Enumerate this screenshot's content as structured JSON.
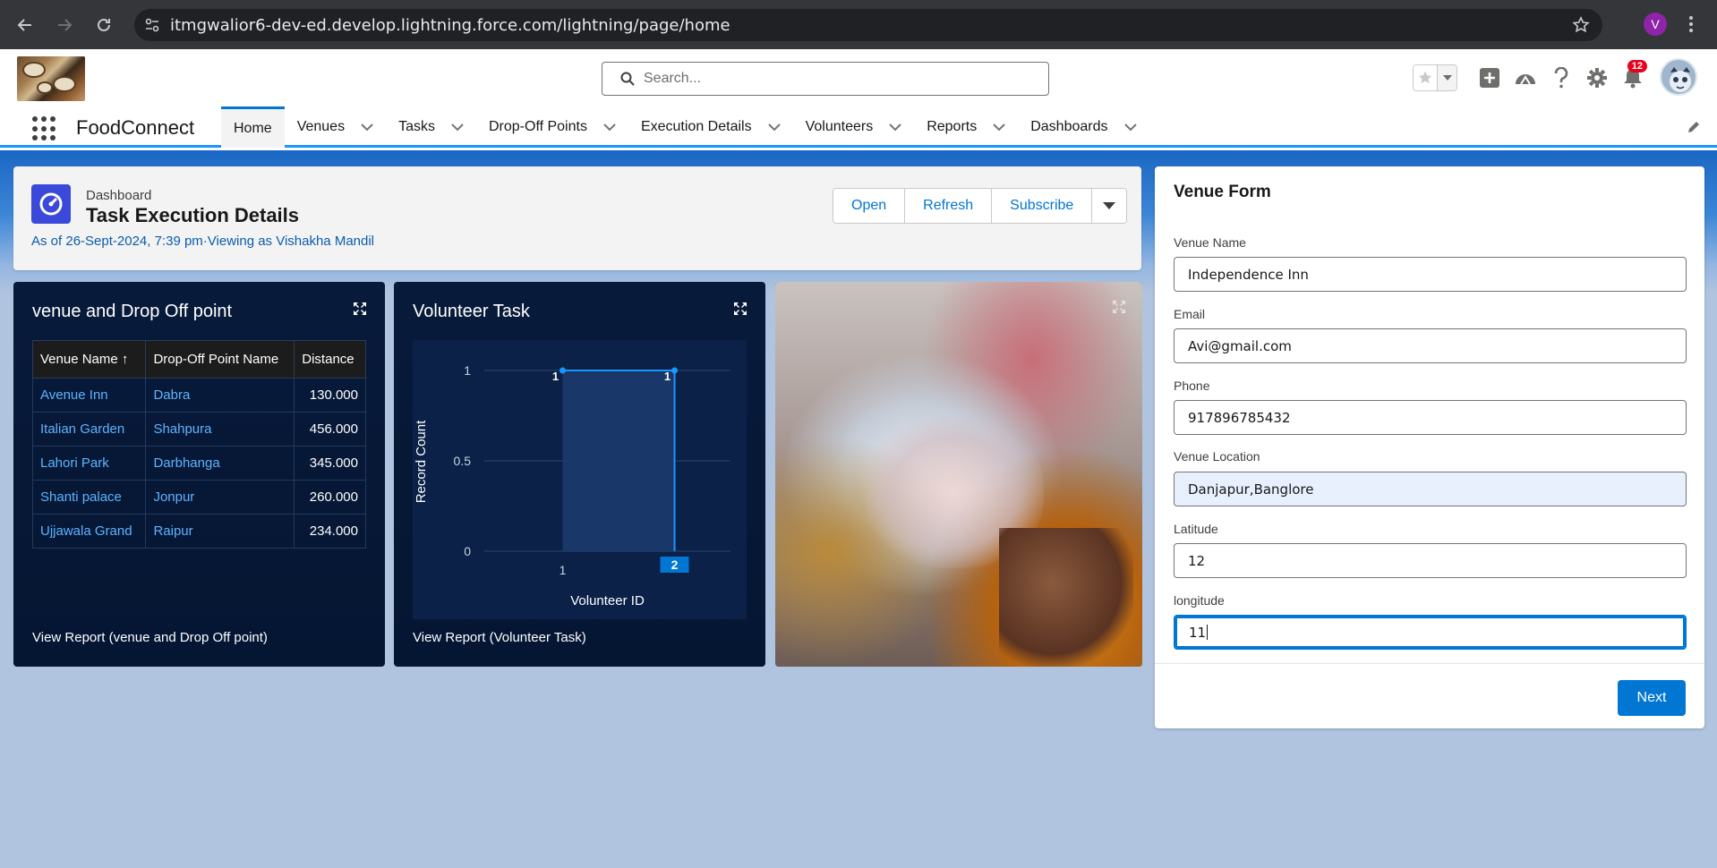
{
  "browser": {
    "url": "itmgwalior6-dev-ed.develop.lightning.force.com/lightning/page/home",
    "profile_initial": "V"
  },
  "header": {
    "search_placeholder": "Search...",
    "notification_count": "12"
  },
  "nav": {
    "app_name": "FoodConnect",
    "items": [
      {
        "label": "Home",
        "active": true
      },
      {
        "label": "Venues"
      },
      {
        "label": "Tasks"
      },
      {
        "label": "Drop-Off Points"
      },
      {
        "label": "Execution Details"
      },
      {
        "label": "Volunteers"
      },
      {
        "label": "Reports"
      },
      {
        "label": "Dashboards"
      }
    ]
  },
  "dashboard": {
    "type_label": "Dashboard",
    "title": "Task Execution Details",
    "subtitle": "As of 26-Sept-2024, 7:39 pm·Viewing as Vishakha Mandil",
    "buttons": {
      "open": "Open",
      "refresh": "Refresh",
      "subscribe": "Subscribe"
    }
  },
  "widget_table": {
    "title": "venue and Drop Off point",
    "columns": [
      "Venue Name ↑",
      "Drop-Off Point Name",
      "Distance"
    ],
    "rows": [
      [
        "Avenue Inn",
        "Dabra",
        "130.000"
      ],
      [
        "Italian Garden",
        "Shahpura",
        "456.000"
      ],
      [
        "Lahori Park",
        "Darbhanga",
        "345.000"
      ],
      [
        "Shanti palace",
        "Jonpur",
        "260.000"
      ],
      [
        "Ujjawala Grand",
        "Raipur",
        "234.000"
      ]
    ],
    "footer": "View Report (venue and Drop Off point)"
  },
  "widget_chart": {
    "title": "Volunteer Task",
    "footer": "View Report (Volunteer Task)"
  },
  "chart_data": {
    "type": "area",
    "x": [
      1,
      2
    ],
    "values": [
      1,
      1
    ],
    "data_labels": [
      "1",
      "1"
    ],
    "xlabel": "Volunteer ID",
    "ylabel": "Record Count",
    "yticks": [
      "0",
      "0.5",
      "1"
    ],
    "xticks": [
      "1",
      "2"
    ],
    "ylim": [
      0,
      1
    ],
    "highlight_tick": "2",
    "colors": {
      "line": "#1b96ff",
      "fill": "#1b3a6b",
      "bg": "#0b2147",
      "highlight": "#0176d3"
    }
  },
  "form": {
    "title": "Venue Form",
    "fields": [
      {
        "label": "Venue Name",
        "value": "Independence Inn"
      },
      {
        "label": "Email",
        "value": "Avi@gmail.com"
      },
      {
        "label": "Phone",
        "value": "917896785432"
      },
      {
        "label": "Venue Location",
        "value": "Danjapur,Banglore"
      },
      {
        "label": "Latitude",
        "value": "12"
      },
      {
        "label": "longitude",
        "value": "11"
      }
    ],
    "next_label": "Next"
  }
}
